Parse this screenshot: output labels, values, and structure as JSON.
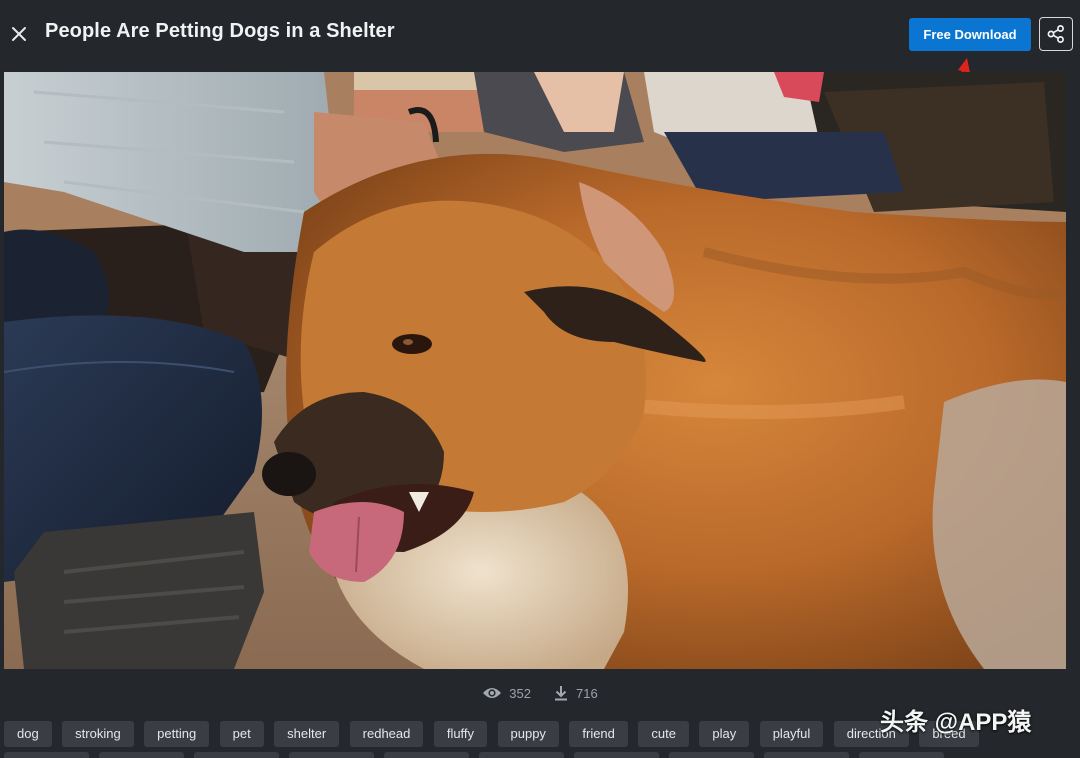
{
  "header": {
    "title": "People Are Petting Dogs in a Shelter",
    "download_label": "Free Download",
    "close_icon": "close-icon",
    "share_icon": "share-icon"
  },
  "stats": {
    "views": "352",
    "downloads": "716",
    "views_icon": "eye-icon",
    "downloads_icon": "download-icon"
  },
  "tags": [
    "dog",
    "stroking",
    "petting",
    "pet",
    "shelter",
    "redhead",
    "fluffy",
    "puppy",
    "friend",
    "cute",
    "play",
    "playful",
    "direction",
    "breed"
  ],
  "watermark": "头条 @APP猿",
  "colors": {
    "background": "#24272c",
    "accent": "#0b76d1",
    "tag_bg": "#3a3e44",
    "annotation": "#e0241b"
  }
}
